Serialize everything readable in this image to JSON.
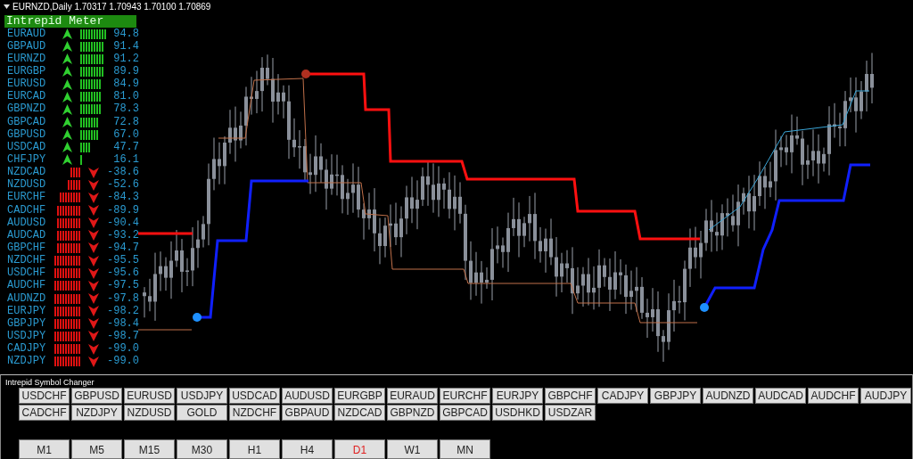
{
  "chart": {
    "header": "EURNZD,Daily  1.70317 1.70943 1.70100 1.70869"
  },
  "meter": {
    "title": "Intrepid Meter",
    "rows": [
      {
        "symbol": "EURAUD",
        "kind": "up",
        "value": "94.8"
      },
      {
        "symbol": "GBPAUD",
        "kind": "up",
        "value": "91.4"
      },
      {
        "symbol": "EURNZD",
        "kind": "up",
        "value": "91.2"
      },
      {
        "symbol": "EURGBP",
        "kind": "up",
        "value": "89.9"
      },
      {
        "symbol": "EURUSD",
        "kind": "up",
        "value": "84.9"
      },
      {
        "symbol": "EURCAD",
        "kind": "up",
        "value": "81.0"
      },
      {
        "symbol": "GBPNZD",
        "kind": "up",
        "value": "78.3"
      },
      {
        "symbol": "GBPCAD",
        "kind": "up",
        "value": "72.8"
      },
      {
        "symbol": "GBPUSD",
        "kind": "up",
        "value": "67.0"
      },
      {
        "symbol": "USDCAD",
        "kind": "up",
        "value": "47.7"
      },
      {
        "symbol": "CHFJPY",
        "kind": "up",
        "value": "16.1"
      },
      {
        "symbol": "NZDCAD",
        "kind": "down",
        "value": "-38.6"
      },
      {
        "symbol": "NZDUSD",
        "kind": "down",
        "value": "-52.6"
      },
      {
        "symbol": "EURCHF",
        "kind": "down",
        "value": "-84.3"
      },
      {
        "symbol": "CADCHF",
        "kind": "down",
        "value": "-89.9"
      },
      {
        "symbol": "AUDUSD",
        "kind": "down",
        "value": "-90.4"
      },
      {
        "symbol": "AUDCAD",
        "kind": "down",
        "value": "-93.2"
      },
      {
        "symbol": "GBPCHF",
        "kind": "down",
        "value": "-94.7"
      },
      {
        "symbol": "NZDCHF",
        "kind": "down",
        "value": "-95.5"
      },
      {
        "symbol": "USDCHF",
        "kind": "down",
        "value": "-95.6"
      },
      {
        "symbol": "AUDCHF",
        "kind": "down",
        "value": "-97.5"
      },
      {
        "symbol": "AUDNZD",
        "kind": "down",
        "value": "-97.8"
      },
      {
        "symbol": "EURJPY",
        "kind": "down",
        "value": "-98.2"
      },
      {
        "symbol": "GBPJPY",
        "kind": "down",
        "value": "-98.4"
      },
      {
        "symbol": "USDJPY",
        "kind": "down",
        "value": "-98.7"
      },
      {
        "symbol": "CADJPY",
        "kind": "down",
        "value": "-99.0"
      },
      {
        "symbol": "NZDJPY",
        "kind": "down",
        "value": "-99.0"
      }
    ]
  },
  "symbol_changer": {
    "title": "Intrepid Symbol Changer",
    "symbol_rows": [
      [
        "USDCHF",
        "GBPUSD",
        "EURUSD",
        "USDJPY",
        "USDCAD",
        "AUDUSD",
        "EURGBP",
        "EURAUD",
        "EURCHF",
        "EURJPY",
        "GBPCHF",
        "CADJPY",
        "GBPJPY",
        "AUDNZD",
        "AUDCAD",
        "AUDCHF",
        "AUDJPY"
      ],
      [
        "CADCHF",
        "NZDJPY",
        "NZDUSD",
        "GOLD",
        "NZDCHF",
        "GBPAUD",
        "NZDCAD",
        "GBPNZD",
        "GBPCAD",
        "USDHKD",
        "USDZAR"
      ]
    ],
    "timeframes": [
      {
        "label": "M1",
        "selected": false
      },
      {
        "label": "M5",
        "selected": false
      },
      {
        "label": "M15",
        "selected": false
      },
      {
        "label": "M30",
        "selected": false
      },
      {
        "label": "H1",
        "selected": false
      },
      {
        "label": "H4",
        "selected": false
      },
      {
        "label": "D1",
        "selected": true
      },
      {
        "label": "W1",
        "selected": false
      },
      {
        "label": "MN",
        "selected": false
      }
    ]
  }
}
